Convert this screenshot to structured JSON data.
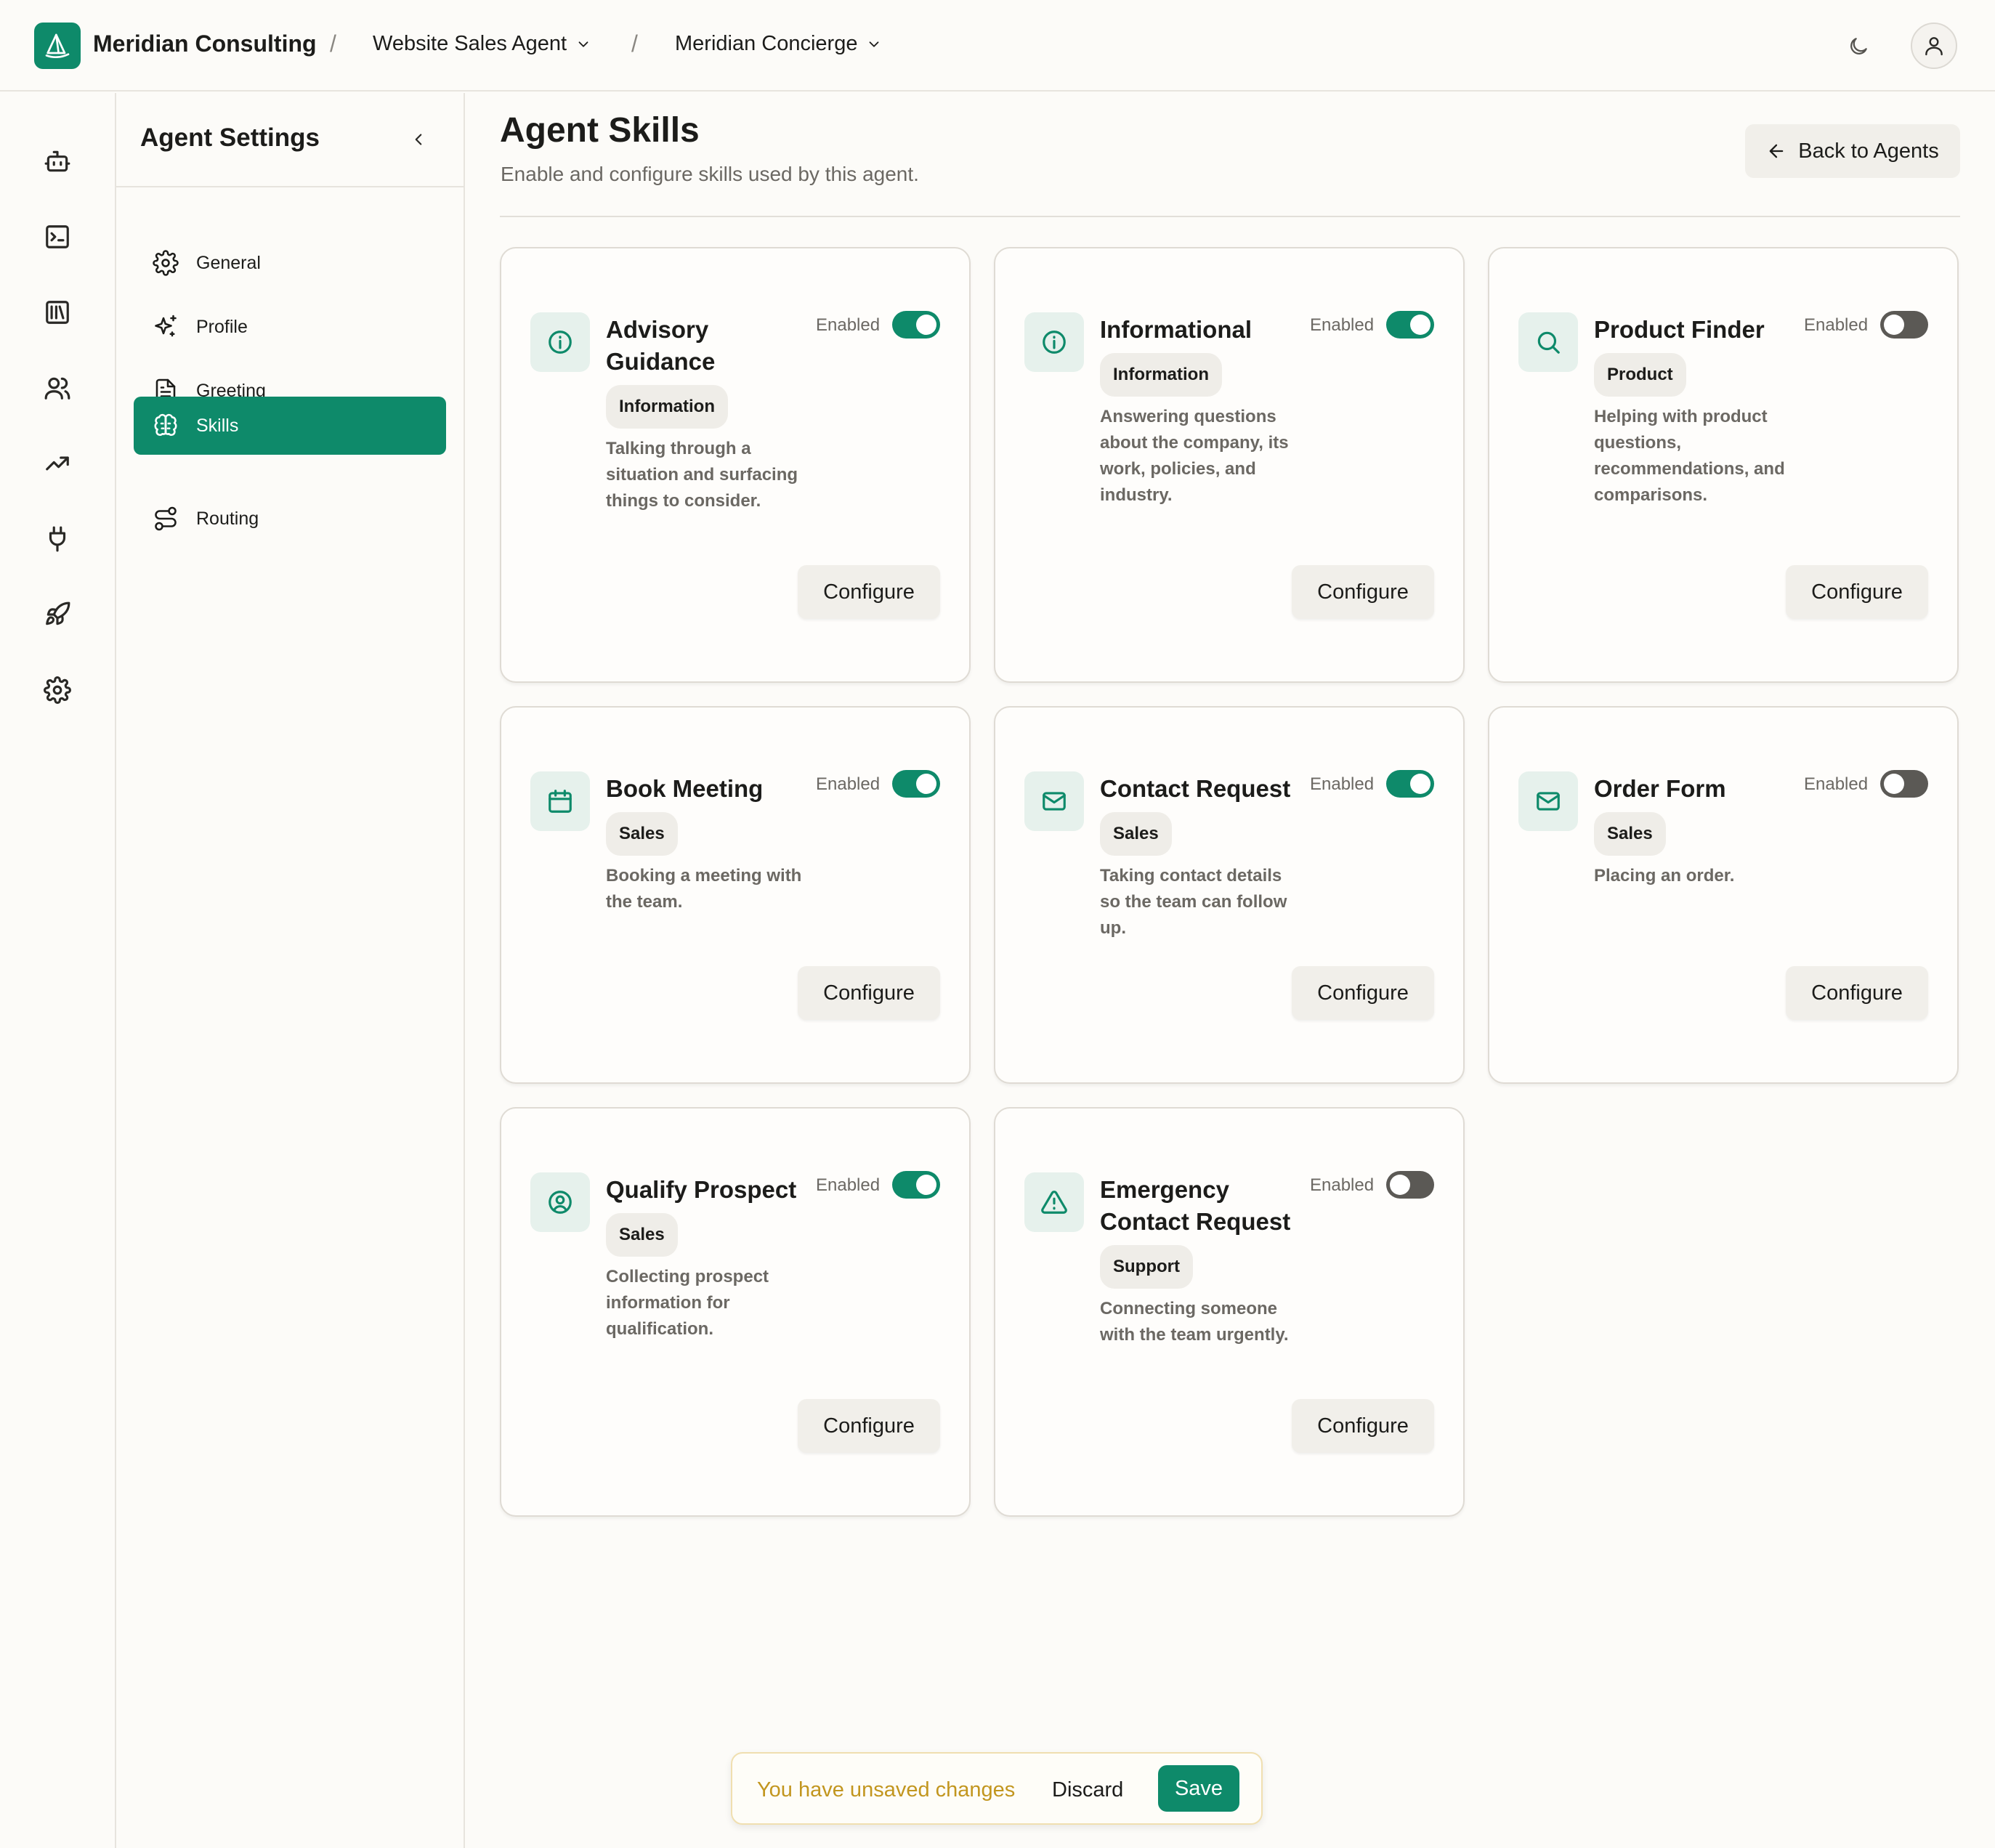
{
  "header": {
    "brand": "Meridian Consulting",
    "separator": "/",
    "crumb1": "Website Sales Agent",
    "crumb2": "Meridian Concierge"
  },
  "rail": [
    "bot-icon",
    "terminal-icon",
    "library-icon",
    "users-icon",
    "trending-up-icon",
    "plug-icon",
    "rocket-icon",
    "settings-icon"
  ],
  "sidebar": {
    "title": "Agent Settings",
    "items": [
      {
        "label": "General",
        "icon": "gear-icon"
      },
      {
        "label": "Profile",
        "icon": "sparkles-icon"
      },
      {
        "label": "Greeting",
        "icon": "document-icon"
      },
      {
        "label": "Skills",
        "icon": "brain-icon",
        "active": true
      },
      {
        "label": "Routing",
        "icon": "route-icon"
      }
    ]
  },
  "main": {
    "title": "Agent Skills",
    "subtitle": "Enable and configure skills used by this agent.",
    "back_label": "Back to Agents"
  },
  "skills": [
    {
      "name": "Advisory Guidance",
      "tag": "Information",
      "desc": "Talking through a situation and surfacing things to consider.",
      "enabled": true,
      "icon": "info-icon"
    },
    {
      "name": "Informational",
      "tag": "Information",
      "desc": "Answering questions about the company, its work, policies, and industry.",
      "enabled": true,
      "icon": "info-icon"
    },
    {
      "name": "Product Finder",
      "tag": "Product",
      "desc": "Helping with product questions, recommendations, and comparisons.",
      "enabled": false,
      "icon": "search-icon"
    },
    {
      "name": "Book Meeting",
      "tag": "Sales",
      "desc": "Booking a meeting with the team.",
      "enabled": true,
      "icon": "calendar-icon"
    },
    {
      "name": "Contact Request",
      "tag": "Sales",
      "desc": "Taking contact details so the team can follow up.",
      "enabled": true,
      "icon": "mail-icon"
    },
    {
      "name": "Order Form",
      "tag": "Sales",
      "desc": "Placing an order.",
      "enabled": false,
      "icon": "mail-icon"
    },
    {
      "name": "Qualify Prospect",
      "tag": "Sales",
      "desc": "Collecting prospect information for qualification.",
      "enabled": true,
      "icon": "user-circle-icon"
    },
    {
      "name": "Emergency Contact Request",
      "tag": "Support",
      "desc": "Connecting someone with the team urgently.",
      "enabled": false,
      "icon": "alert-triangle-icon"
    }
  ],
  "labels": {
    "enabled": "Enabled",
    "configure": "Configure"
  },
  "unsaved": {
    "message": "You have unsaved changes",
    "discard": "Discard",
    "save": "Save"
  },
  "colors": {
    "accent": "#0e8a6a",
    "warning_text": "#c2961f",
    "toggle_off": "#5b5955"
  }
}
